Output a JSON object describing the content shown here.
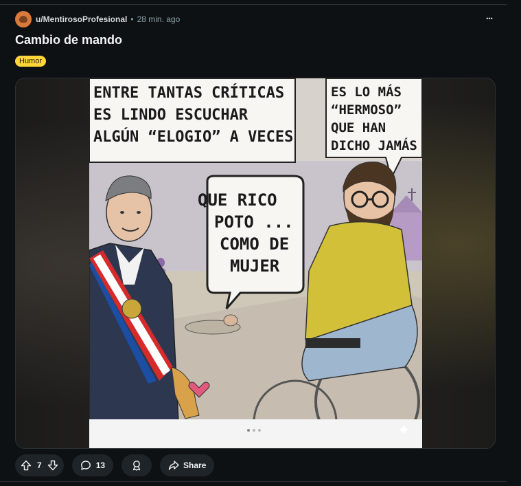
{
  "post": {
    "username": "u/MentirosoProfesional",
    "separator": "•",
    "time_ago": "28 min. ago",
    "more_label": "•••",
    "title": "Cambio de mando",
    "flair": "Humor"
  },
  "comic": {
    "caption_left": [
      "ENTRE TANTAS CRÍTICAS",
      "ES LINDO ESCUCHAR",
      "ALGÚN “ELOGIO” A VECES"
    ],
    "caption_right": [
      "ES LO MÁS",
      "“HERMOSO”",
      "QUE HAN",
      "DICHO JAMÁS"
    ],
    "speech": [
      "QUE RICO",
      "POTO ...",
      "COMO DE",
      "MUJER"
    ]
  },
  "actions": {
    "upvotes": "7",
    "comments": "13",
    "share_label": "Share"
  },
  "colors": {
    "background": "#0e1113",
    "pill": "#1f2428",
    "flair": "#ffd635",
    "avatar": "#d9793b"
  }
}
